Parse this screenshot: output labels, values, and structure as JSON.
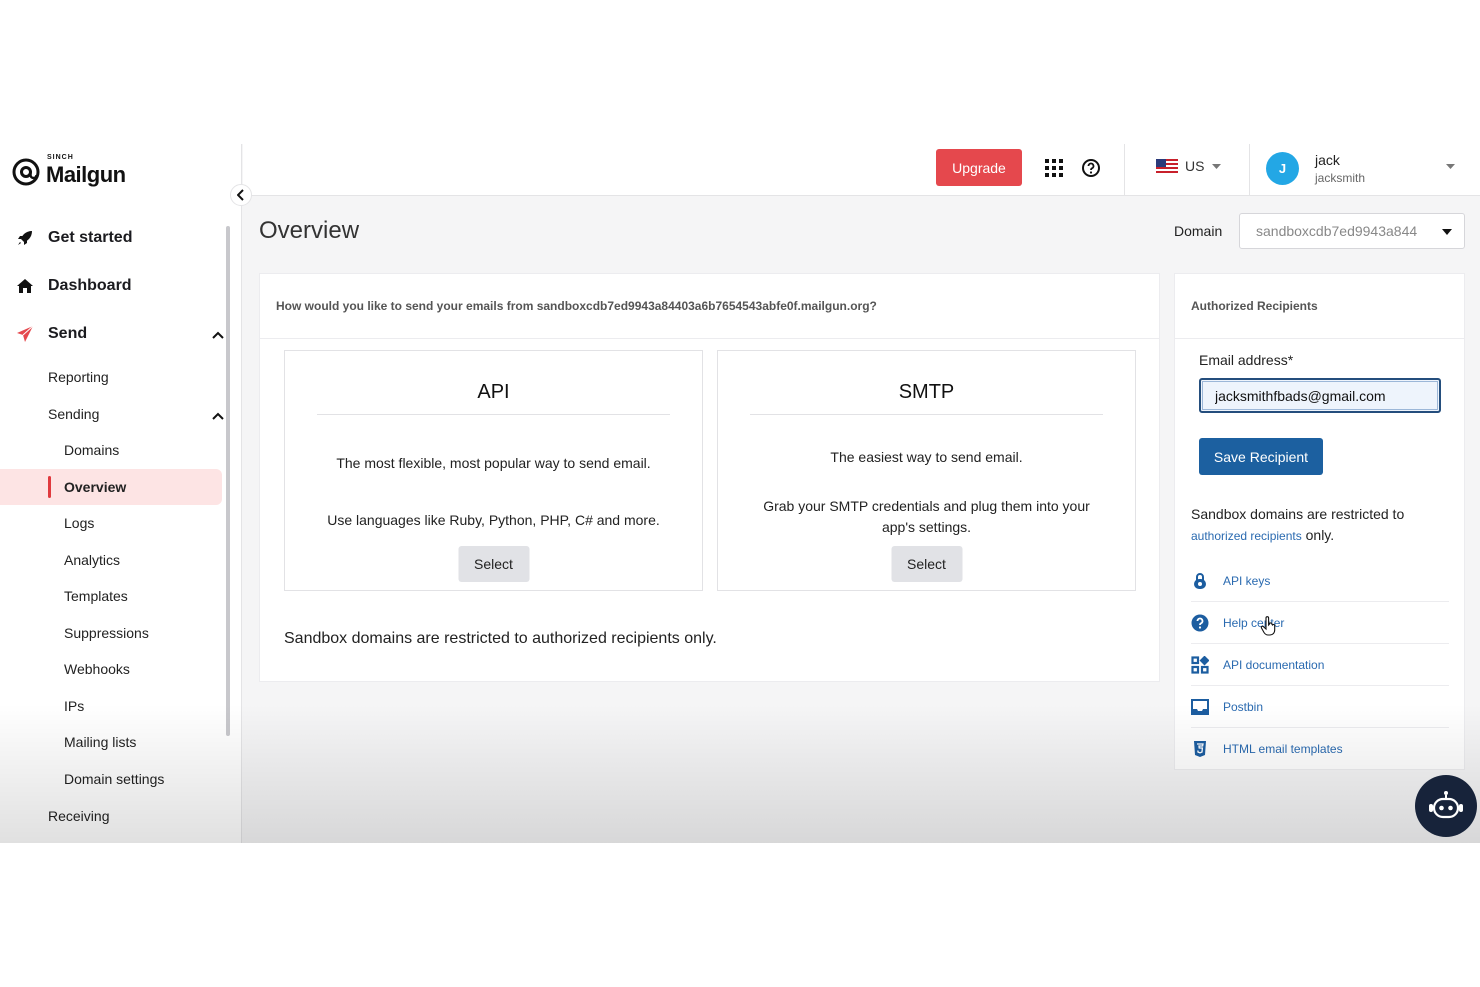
{
  "brand": {
    "small": "SINCH",
    "name": "Mailgun"
  },
  "sidebar": {
    "top_items": [
      {
        "label": "Get started",
        "icon": "rocket-icon"
      },
      {
        "label": "Dashboard",
        "icon": "home-icon"
      },
      {
        "label": "Send",
        "icon": "send-icon"
      }
    ],
    "send_items": [
      {
        "label": "Reporting"
      },
      {
        "label": "Sending"
      }
    ],
    "sending_items": [
      {
        "label": "Domains"
      },
      {
        "label": "Overview"
      },
      {
        "label": "Logs"
      },
      {
        "label": "Analytics"
      },
      {
        "label": "Templates"
      },
      {
        "label": "Suppressions"
      },
      {
        "label": "Webhooks"
      },
      {
        "label": "IPs"
      },
      {
        "label": "Mailing lists"
      },
      {
        "label": "Domain settings"
      }
    ],
    "receiving_label": "Receiving"
  },
  "header": {
    "upgrade_label": "Upgrade",
    "region": "US",
    "user": {
      "initial": "J",
      "name": "jack",
      "handle": "jacksmith"
    }
  },
  "main": {
    "title": "Overview",
    "domain_label": "Domain",
    "domain_value": "sandboxcdb7ed9943a844",
    "question": "How would you like to send your emails from sandboxcdb7ed9943a84403a6b7654543abfe0f.mailgun.org?",
    "options": [
      {
        "title": "API",
        "line1": "The most flexible, most popular way to send email.",
        "line2": "Use languages like Ruby, Python, PHP, C# and more.",
        "button": "Select"
      },
      {
        "title": "SMTP",
        "line1": "The easiest way to send email.",
        "line2": "Grab your SMTP credentials and plug them into your app's settings.",
        "button": "Select"
      }
    ],
    "note": "Sandbox domains are restricted to authorized recipients only."
  },
  "side": {
    "title": "Authorized Recipients",
    "email_label": "Email address*",
    "email_value": "jacksmithfbads@gmail.com",
    "save_label": "Save Recipient",
    "restrict_prefix": "Sandbox domains are restricted to",
    "restrict_link": "authorized recipients",
    "restrict_suffix": "only.",
    "links": [
      {
        "label": "API keys",
        "icon": "lock-icon"
      },
      {
        "label": "Help center",
        "icon": "help-circle-icon"
      },
      {
        "label": "API documentation",
        "icon": "grid-blocks-icon"
      },
      {
        "label": "Postbin",
        "icon": "inbox-icon"
      },
      {
        "label": "HTML email templates",
        "icon": "html5-icon"
      }
    ]
  },
  "colors": {
    "accent": "#e5484d",
    "primary": "#1c60a0",
    "avatar": "#23a7e5",
    "active_bg": "#fde4e4"
  }
}
